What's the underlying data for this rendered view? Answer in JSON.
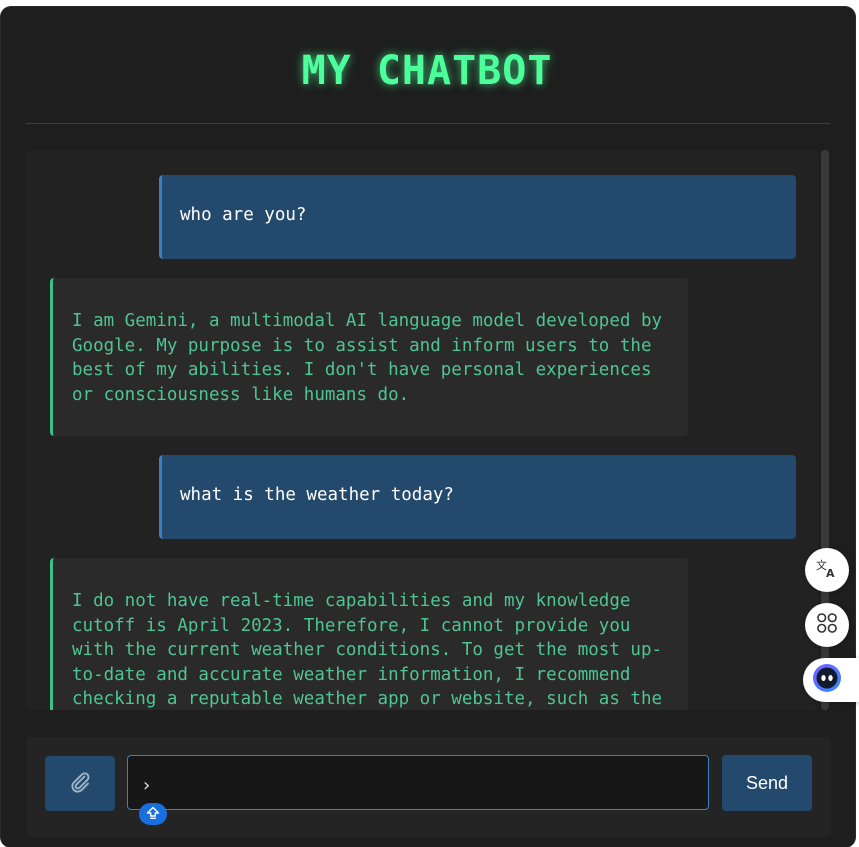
{
  "app": {
    "title": "MY CHATBOT"
  },
  "messages": [
    {
      "role": "user",
      "text": "who are you?"
    },
    {
      "role": "bot",
      "text": "I am Gemini, a multimodal AI language model developed by Google. My purpose is to assist and inform users to the best of my abilities. I don't have personal experiences or consciousness like humans do."
    },
    {
      "role": "user",
      "text": "what is the weather today?"
    },
    {
      "role": "bot",
      "text": "I do not have real-time capabilities and my knowledge cutoff is April 2023. Therefore, I cannot provide you with the current weather conditions. To get the most up-to-date and accurate weather information, I recommend checking a reputable weather app or website, such as the"
    }
  ],
  "composer": {
    "input_value": "",
    "caret_glyph": "›",
    "send_label": "Send",
    "attach_icon": "paperclip-icon",
    "shift_icon": "shift-up-arrow-icon"
  },
  "floating_tools": {
    "translate_icon": "translate-icon",
    "apps_icon": "apps-grid-icon",
    "assistant_icon": "assistant-face-icon"
  },
  "colors": {
    "background": "#1e1e1e",
    "title_glow": "#4dff9a",
    "user_bubble": "#234a6d",
    "bot_text": "#4fc495",
    "accent_blue": "#3b7fc4"
  }
}
